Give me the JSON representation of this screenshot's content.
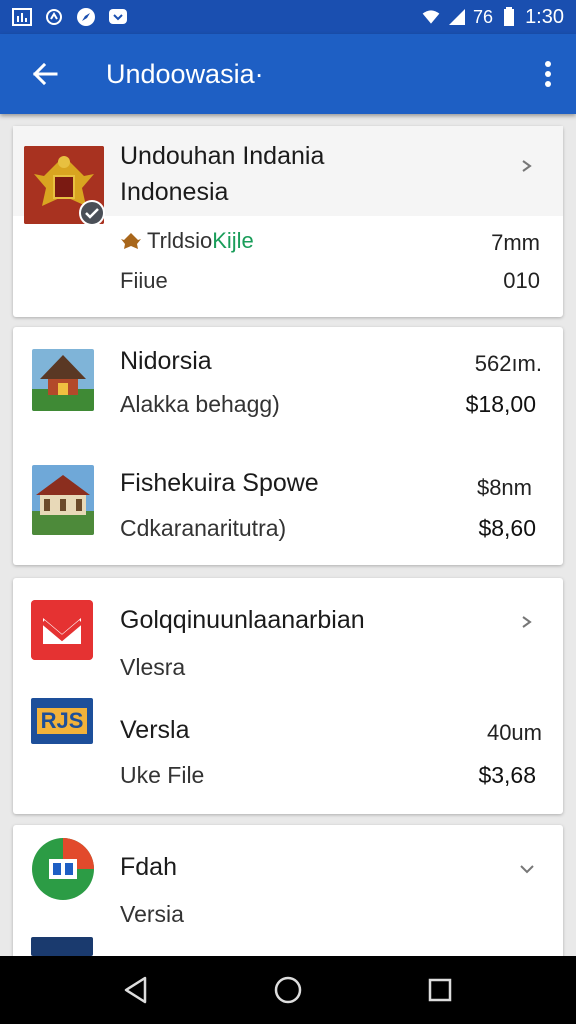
{
  "status_bar": {
    "signal_text": "76",
    "time": "1:30"
  },
  "app_bar": {
    "title": "Undoowasia·"
  },
  "card1": {
    "title_line1": "Undouhan Indania",
    "title_line2": "Indonesia",
    "source_prefix": "Trldsio",
    "source_accent": "Kijle",
    "source_right": "7mm",
    "file_label": "Fiiue",
    "file_value": "010",
    "accent_color": "#1a9d5a"
  },
  "card2": {
    "item1": {
      "title": "Nidorsia",
      "right_top": "562ım.",
      "subtitle": "Alakka behagg)",
      "price": "$18,00"
    },
    "item2": {
      "title": "Fishekuira Spowe",
      "right_top": "$8nm",
      "subtitle": "Cdkaranaritutra)",
      "price": "$8,60"
    }
  },
  "card3": {
    "item1": {
      "title": "Golqqinuunlaanarbian",
      "subtitle": "Vlesra"
    },
    "item2": {
      "title": "Versla",
      "right_top": "40um",
      "subtitle": "Uke File",
      "price": "$3,68",
      "thumb_text": "RJS"
    }
  },
  "card4": {
    "item1": {
      "title": "Fdah",
      "subtitle": "Versia"
    }
  }
}
